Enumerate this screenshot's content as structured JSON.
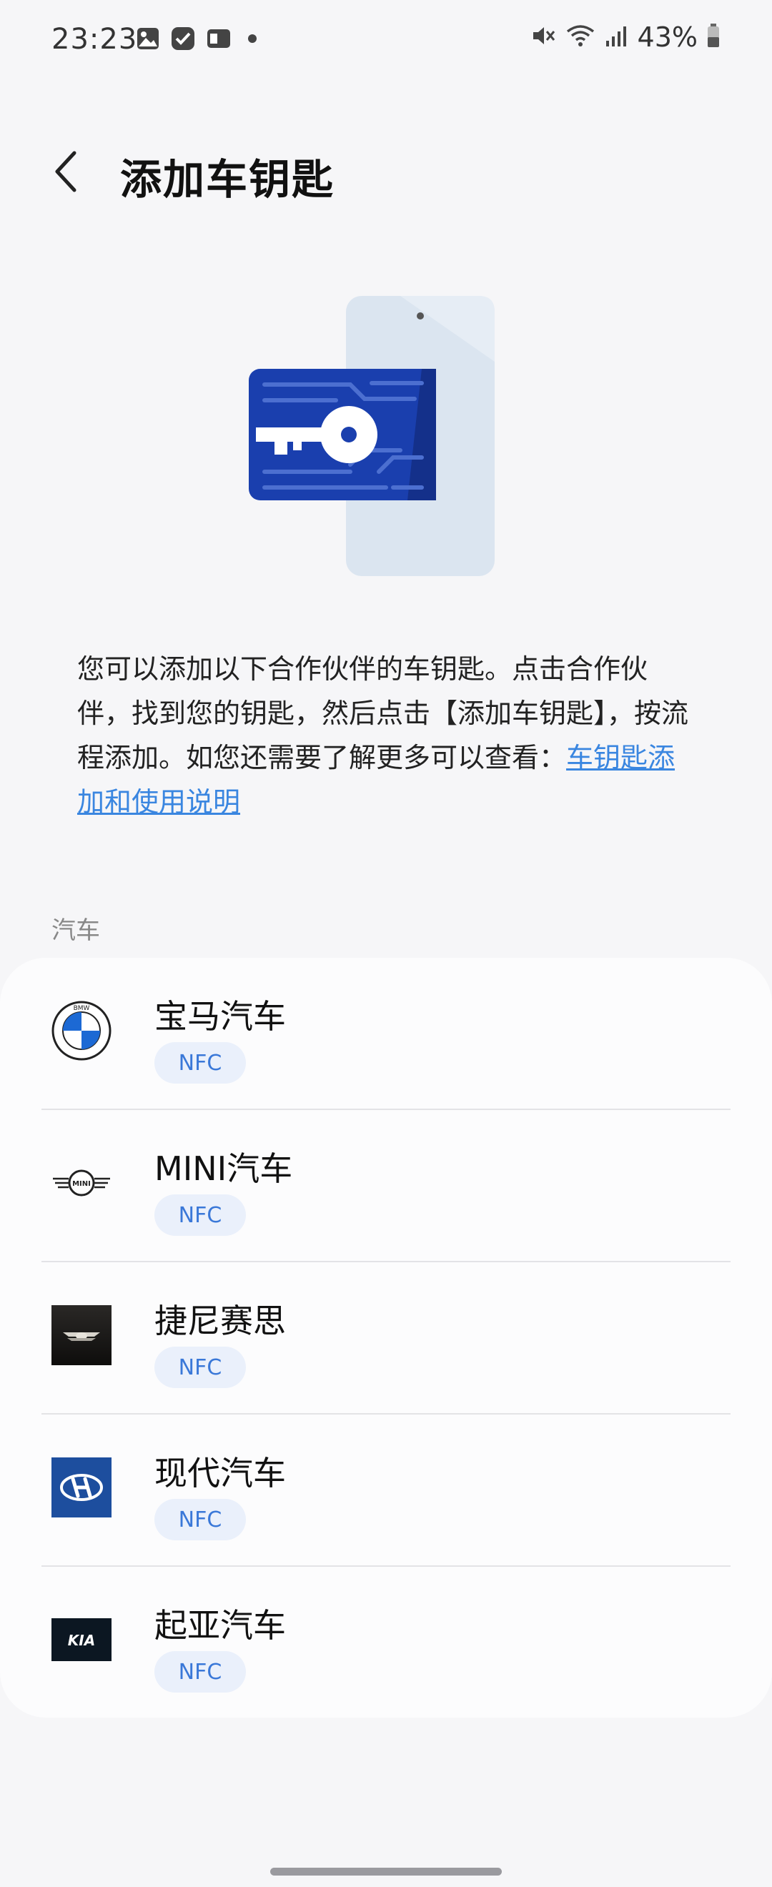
{
  "status_bar": {
    "time": "23:23",
    "battery": "43%",
    "left_icons": [
      "gallery-icon",
      "tasks-icon",
      "wallet-icon",
      "dot-icon"
    ],
    "right_icons": [
      "mute-icon",
      "wifi-icon",
      "signal-icon",
      "battery-icon"
    ]
  },
  "header": {
    "title": "添加车钥匙"
  },
  "description": {
    "text": "您可以添加以下合作伙伴的车钥匙。点击合作伙伴，找到您的钥匙，然后点击【添加车钥匙】，按流程添加。如您还需要了解更多可以查看：",
    "link": "车钥匙添加和使用说明"
  },
  "section": {
    "label": "汽车",
    "items": [
      {
        "name": "宝马汽车",
        "badge": "NFC",
        "logo": "bmw-logo-icon"
      },
      {
        "name": "MINI汽车",
        "badge": "NFC",
        "logo": "mini-logo-icon"
      },
      {
        "name": "捷尼赛思",
        "badge": "NFC",
        "logo": "genesis-logo-icon"
      },
      {
        "name": "现代汽车",
        "badge": "NFC",
        "logo": "hyundai-logo-icon"
      },
      {
        "name": "起亚汽车",
        "badge": "NFC",
        "logo": "kia-logo-icon"
      }
    ]
  },
  "logo_texts": {
    "bmw": "BMW",
    "mini": "MINI",
    "kia": "KIA"
  },
  "colors": {
    "accent": "#3a86e0",
    "badge_bg": "#eaf0fb",
    "badge_text": "#3a78d8",
    "card_blue": "#1a3fae"
  }
}
